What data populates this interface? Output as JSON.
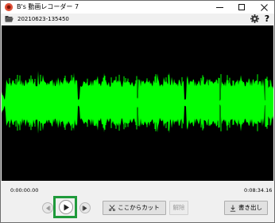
{
  "window": {
    "title": "B's 動画レコーダー 7"
  },
  "toolbar": {
    "file_name": "20210623-135450",
    "help_label": "?"
  },
  "timeline": {
    "start_time": "0:00:00.00",
    "end_time": "0:08:34.16"
  },
  "controls": {
    "cut_label": "ここからカット",
    "release_label": "解除",
    "export_label": "書き出し"
  },
  "colors": {
    "waveform": "#00ff00",
    "background": "#000000",
    "highlight": "#1f9a3b",
    "app_icon": "#c8321e"
  },
  "icons": {
    "app": "app-record-icon",
    "folder": "folder-open-icon",
    "settings": "gear-icon",
    "help": "help-icon",
    "prev": "prev-marker-icon",
    "play": "play-icon",
    "next": "next-marker-icon",
    "cut": "scissors-icon",
    "export": "download-icon"
  }
}
